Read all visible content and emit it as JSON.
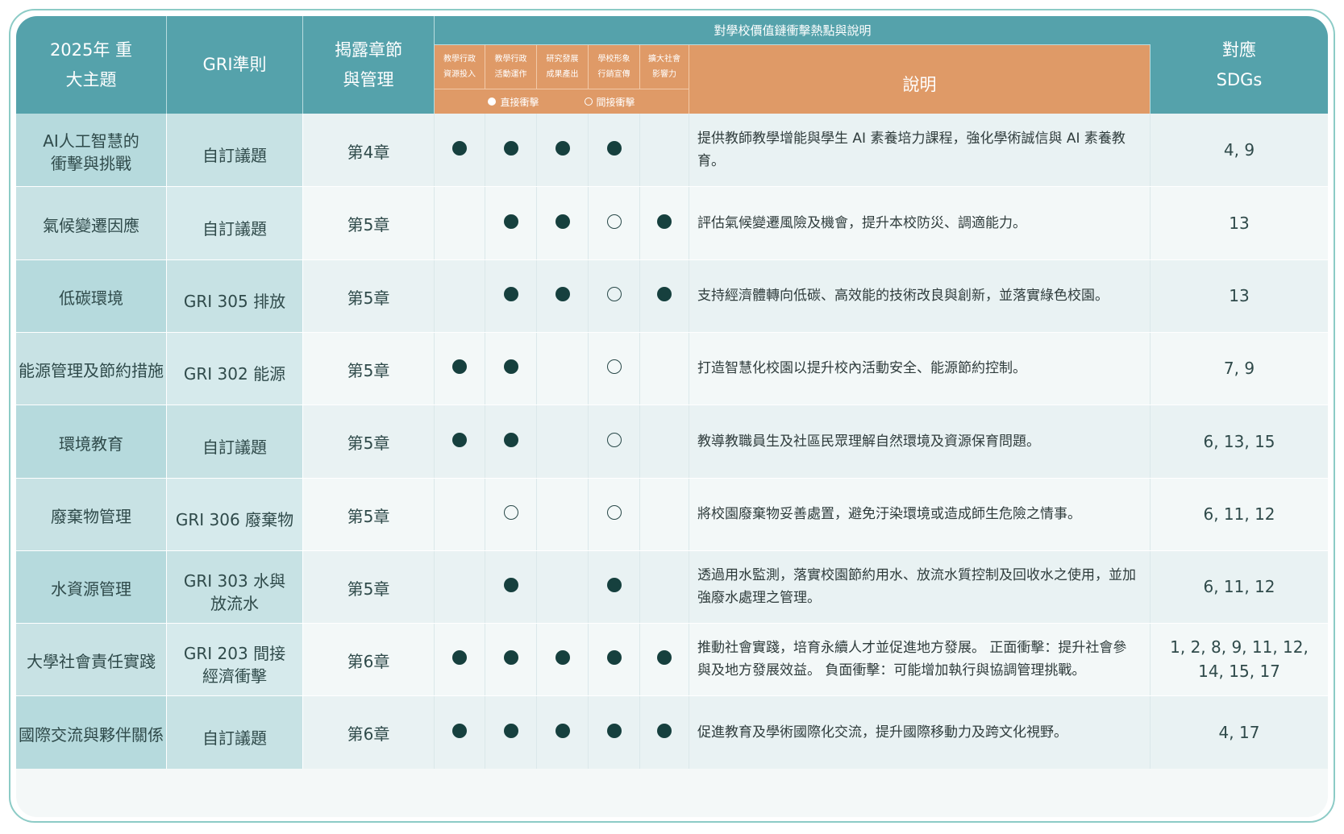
{
  "table": {
    "header": {
      "topic": "2025年 重大主題",
      "gri": "GRI準則",
      "chapter": "揭露章節 與管理",
      "group": "對學校價值鏈衝擊熱點與說明",
      "value_chain": [
        "教學行政 資源投入",
        "教學行政 活動運作",
        "研究發展 成果產出",
        "學校形象 行銷宣傳",
        "擴大社會 影響力"
      ],
      "legend_direct": "直接衝擊",
      "legend_indirect": "間接衝擊",
      "description": "說明",
      "sdgs": "對應 SDGs"
    },
    "rows": [
      {
        "topic": "AI人工智慧的 衝擊與挑戰",
        "gri": "自訂議題",
        "chapter": "第4章",
        "marks": [
          "direct",
          "direct",
          "direct",
          "direct",
          ""
        ],
        "description": "提供教師教學增能與學生 AI 素養培力課程，強化學術誠信與 AI 素養教育。",
        "sdgs": "4, 9"
      },
      {
        "topic": "氣候變遷因應",
        "gri": "自訂議題",
        "chapter": "第5章",
        "marks": [
          "",
          "direct",
          "direct",
          "indirect",
          "direct"
        ],
        "description": "評估氣候變遷風險及機會，提升本校防災、調適能力。",
        "sdgs": "13"
      },
      {
        "topic": "低碳環境",
        "gri": "GRI 305 排放",
        "chapter": "第5章",
        "marks": [
          "",
          "direct",
          "direct",
          "indirect",
          "direct"
        ],
        "description": "支持經濟體轉向低碳、高效能的技術改良與創新，並落實綠色校園。",
        "sdgs": "13"
      },
      {
        "topic": "能源管理及節約措施",
        "gri": "GRI 302 能源",
        "chapter": "第5章",
        "marks": [
          "direct",
          "direct",
          "",
          "indirect",
          ""
        ],
        "description": "打造智慧化校園以提升校內活動安全、能源節約控制。",
        "sdgs": "7, 9"
      },
      {
        "topic": "環境教育",
        "gri": "自訂議題",
        "chapter": "第5章",
        "marks": [
          "direct",
          "direct",
          "",
          "indirect",
          ""
        ],
        "description": "教導教職員生及社區民眾理解自然環境及資源保育問題。",
        "sdgs": "6, 13, 15"
      },
      {
        "topic": "廢棄物管理",
        "gri": "GRI 306 廢棄物",
        "chapter": "第5章",
        "marks": [
          "",
          "indirect",
          "",
          "indirect",
          ""
        ],
        "description": "將校園廢棄物妥善處置，避免汙染環境或造成師生危險之情事。",
        "sdgs": "6, 11, 12"
      },
      {
        "topic": "水資源管理",
        "gri": "GRI 303 水與放流水",
        "chapter": "第5章",
        "marks": [
          "",
          "direct",
          "",
          "direct",
          ""
        ],
        "description": "透過用水監測，落實校園節約用水、放流水質控制及回收水之使用，並加強廢水處理之管理。",
        "sdgs": "6, 11, 12"
      },
      {
        "topic": "大學社會責任實踐",
        "gri": "GRI 203 間接經濟衝擊",
        "chapter": "第6章",
        "marks": [
          "direct",
          "direct",
          "direct",
          "direct",
          "direct"
        ],
        "description": "推動社會實踐，培育永續人才並促進地方發展。 正面衝擊：提升社會參與及地方發展效益。 負面衝擊：可能增加執行與協調管理挑戰。",
        "sdgs": "1, 2, 8, 9, 11, 12, 14, 15, 17"
      },
      {
        "topic": "國際交流與夥伴關係",
        "gri": "自訂議題",
        "chapter": "第6章",
        "marks": [
          "direct",
          "direct",
          "direct",
          "direct",
          "direct"
        ],
        "description": "促進教育及學術國際化交流，提升國際移動力及跨文化視野。",
        "sdgs": "4, 17"
      }
    ],
    "colors": {
      "teal": "#55a2ab",
      "orange": "#df9a67",
      "dot": "#16403e"
    }
  }
}
